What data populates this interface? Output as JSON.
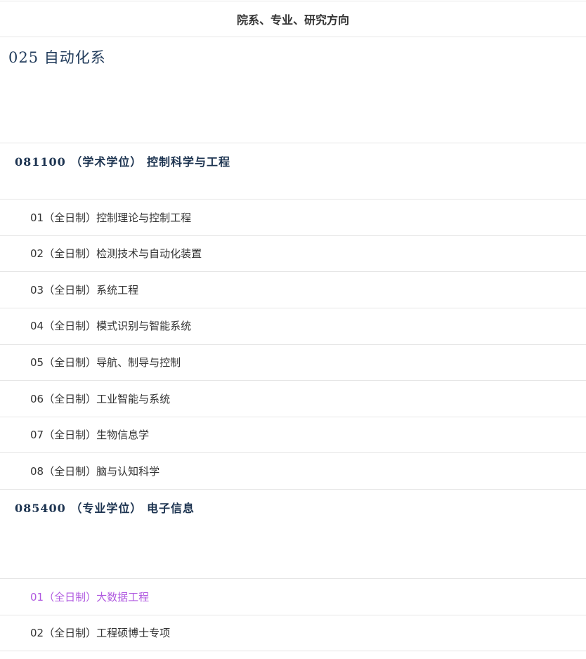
{
  "header": {
    "title": "院系、专业、研究方向"
  },
  "department": {
    "label": "025 自动化系"
  },
  "majors": [
    {
      "label": "081100 （学术学位） 控制科学与工程",
      "directions": [
        {
          "label": "01（全日制）控制理论与控制工程"
        },
        {
          "label": "02（全日制）检测技术与自动化装置"
        },
        {
          "label": "03（全日制）系统工程"
        },
        {
          "label": "04（全日制）模式识别与智能系统"
        },
        {
          "label": "05（全日制）导航、制导与控制"
        },
        {
          "label": "06（全日制）工业智能与系统"
        },
        {
          "label": "07（全日制）生物信息学"
        },
        {
          "label": "08（全日制）脑与认知科学"
        }
      ]
    },
    {
      "label": "085400 （专业学位） 电子信息",
      "directions": [
        {
          "label": "01（全日制）大数据工程"
        },
        {
          "label": "02（全日制）工程硕博士专项"
        }
      ]
    }
  ],
  "colors": {
    "visited_link": "#b05ae0",
    "heading": "#1c3350",
    "divider": "#e6e6e6"
  }
}
